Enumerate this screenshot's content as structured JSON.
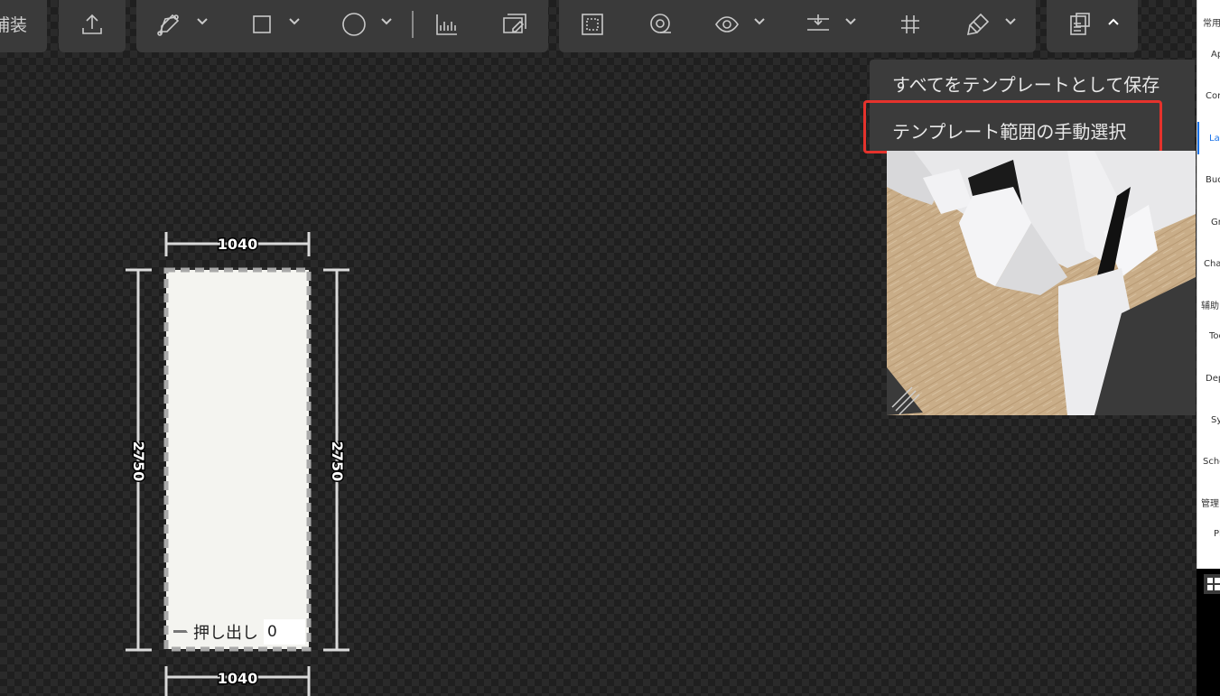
{
  "toolbar": {
    "left_label": "補装"
  },
  "menu": {
    "items": [
      "すべてをテンプレートとして保存",
      "テンプレート範囲の手動選択"
    ]
  },
  "dimensions": {
    "top": "1040",
    "bottom": "1040",
    "left": "2750",
    "right": "2750"
  },
  "extrude": {
    "label": "押し出し",
    "value": "0"
  },
  "right_panel": {
    "items": [
      "常用",
      "Ap",
      "Cor",
      "Lar",
      "Bud",
      "Gr",
      "Cha",
      "辅助",
      "Too",
      "Dep",
      "Sy",
      "Sche",
      "管理",
      "Pl"
    ]
  }
}
